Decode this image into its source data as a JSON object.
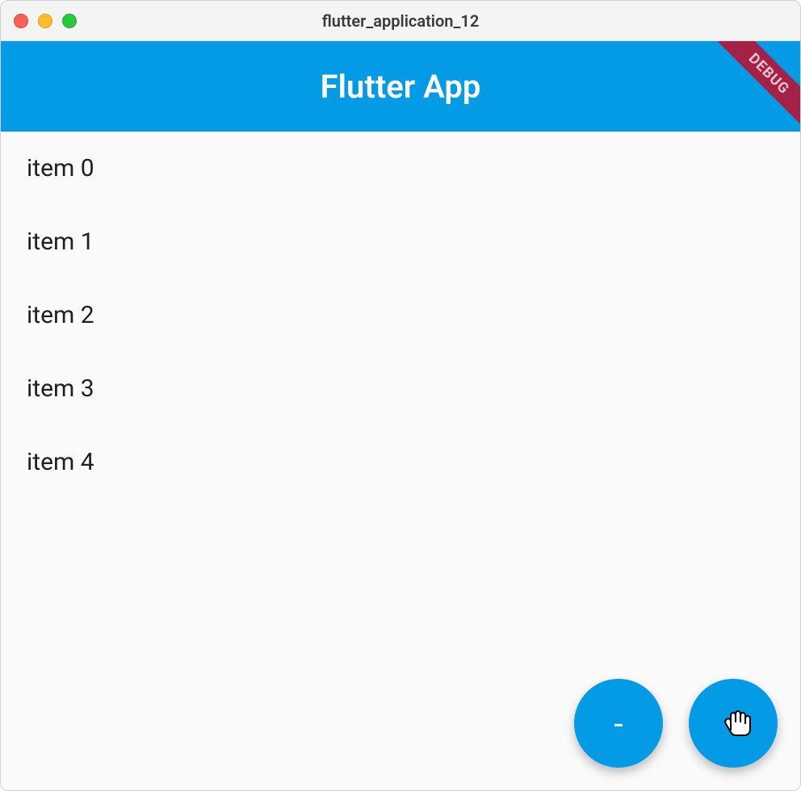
{
  "window": {
    "title": "flutter_application_12"
  },
  "appBar": {
    "title": "Flutter App"
  },
  "debugBanner": {
    "label": "DEBUG"
  },
  "list": {
    "items": [
      {
        "label": "item 0"
      },
      {
        "label": "item 1"
      },
      {
        "label": "item 2"
      },
      {
        "label": "item 3"
      },
      {
        "label": "item 4"
      }
    ]
  },
  "fabs": {
    "minus": {
      "icon": "-"
    },
    "plus": {
      "icon": "+"
    }
  },
  "colors": {
    "primary": "#039be5",
    "debugBanner": "#a52148"
  }
}
